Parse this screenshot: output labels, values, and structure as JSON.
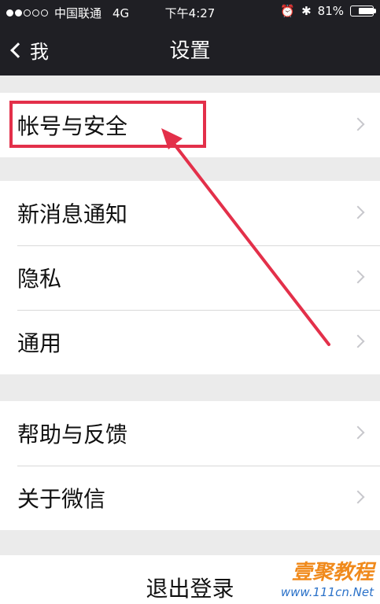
{
  "status_bar": {
    "carrier": "中国联通",
    "network": "4G",
    "time": "下午4:27",
    "battery": "81%",
    "battery_level": 0.81
  },
  "nav": {
    "back_label": "我",
    "title": "设置"
  },
  "groups": [
    {
      "items": [
        {
          "label": "帐号与安全"
        }
      ]
    },
    {
      "items": [
        {
          "label": "新消息通知"
        },
        {
          "label": "隐私"
        },
        {
          "label": "通用"
        }
      ]
    },
    {
      "items": [
        {
          "label": "帮助与反馈"
        },
        {
          "label": "关于微信"
        }
      ]
    }
  ],
  "logout_label": "退出登录",
  "annotation_color": "#e3304a",
  "watermark": {
    "brand": "壹聚教程",
    "url": "www.111cn.Net"
  }
}
